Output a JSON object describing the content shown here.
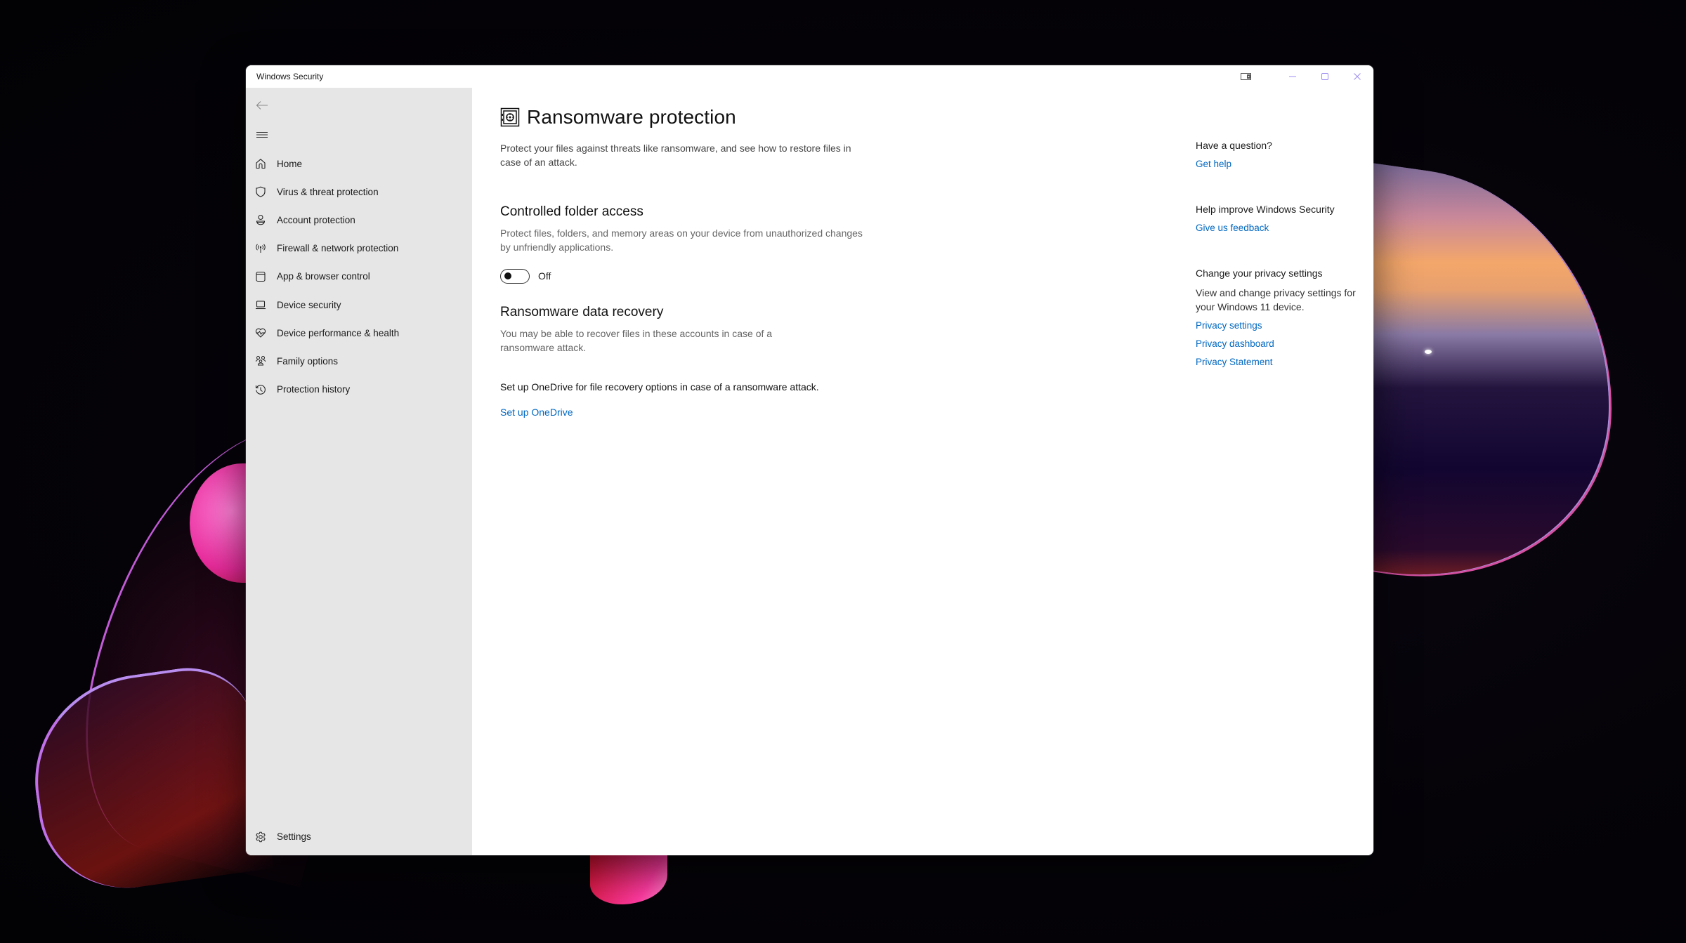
{
  "window": {
    "title": "Windows Security",
    "controls": {
      "extra_icon": "tablet-mode-icon",
      "minimize_icon": "minimize-icon",
      "maximize_icon": "maximize-icon",
      "close_icon": "close-icon"
    }
  },
  "sidebar": {
    "back_icon": "back-arrow-icon",
    "menu_icon": "hamburger-menu-icon",
    "items": [
      {
        "label": "Home",
        "icon": "home-icon"
      },
      {
        "label": "Virus & threat protection",
        "icon": "shield-icon"
      },
      {
        "label": "Account protection",
        "icon": "person-icon"
      },
      {
        "label": "Firewall & network protection",
        "icon": "antenna-icon"
      },
      {
        "label": "App & browser control",
        "icon": "app-window-icon"
      },
      {
        "label": "Device security",
        "icon": "laptop-icon"
      },
      {
        "label": "Device performance & health",
        "icon": "heart-pulse-icon"
      },
      {
        "label": "Family options",
        "icon": "family-icon"
      },
      {
        "label": "Protection history",
        "icon": "history-icon"
      }
    ],
    "settings": {
      "label": "Settings",
      "icon": "gear-icon"
    }
  },
  "main": {
    "page_icon": "safe-vault-icon",
    "title": "Ransomware protection",
    "intro": "Protect your files against threats like ransomware, and see how to restore files in case of an attack.",
    "controlled_folder_access": {
      "title": "Controlled folder access",
      "description": "Protect files, folders, and memory areas on your device from unauthorized changes by unfriendly applications.",
      "toggle_state": "Off",
      "toggle_on": false
    },
    "data_recovery": {
      "title": "Ransomware data recovery",
      "description": "You may be able to recover files in these accounts in case of a ransomware attack.",
      "onedrive_text": "Set up OneDrive for file recovery options in case of a ransomware attack.",
      "onedrive_link": "Set up OneDrive"
    }
  },
  "rail": {
    "question": {
      "heading": "Have a question?",
      "link": "Get help"
    },
    "improve": {
      "heading": "Help improve Windows Security",
      "link": "Give us feedback"
    },
    "privacy": {
      "heading": "Change your privacy settings",
      "description": "View and change privacy settings for your Windows 11 device.",
      "links": [
        "Privacy settings",
        "Privacy dashboard",
        "Privacy Statement"
      ]
    }
  },
  "colors": {
    "accent_link": "#0067c0",
    "sidebar_bg": "#e6e6e6",
    "window_bg": "#ffffff",
    "window_controls": "#9c8cf0"
  }
}
